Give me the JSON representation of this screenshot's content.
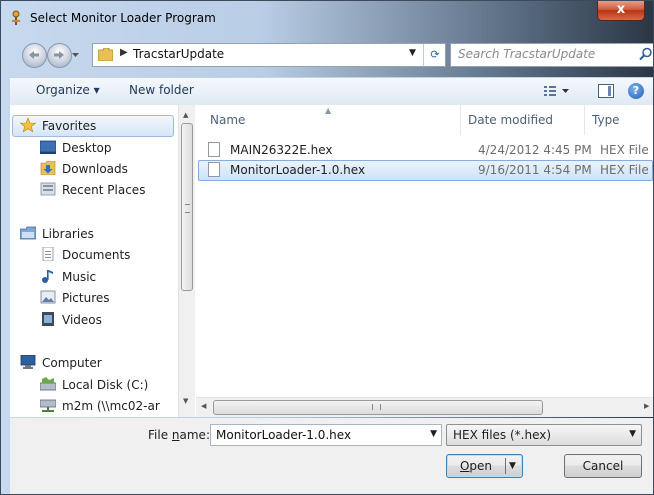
{
  "window": {
    "title": "Select Monitor Loader Program",
    "close_label": "x"
  },
  "navbar": {
    "path_folder": "TracstarUpdate",
    "search_placeholder": "Search TracstarUpdate"
  },
  "toolbar": {
    "organize_label": "Organize ▾",
    "new_folder_label": "New folder",
    "help_label": "?"
  },
  "nav_pane": {
    "favorites": {
      "label": "Favorites",
      "items": [
        "Desktop",
        "Downloads",
        "Recent Places"
      ]
    },
    "libraries": {
      "label": "Libraries",
      "items": [
        "Documents",
        "Music",
        "Pictures",
        "Videos"
      ]
    },
    "computer": {
      "label": "Computer",
      "items": [
        "Local Disk (C:)",
        "m2m (\\\\mc02-ar"
      ]
    }
  },
  "file_list": {
    "columns": [
      "Name",
      "Date modified",
      "Type"
    ],
    "rows": [
      {
        "name": "MAIN26322E.hex",
        "date": "4/24/2012 4:45 PM",
        "type": "HEX File",
        "selected": false
      },
      {
        "name": "MonitorLoader-1.0.hex",
        "date": "9/16/2011 4:54 PM",
        "type": "HEX File",
        "selected": true
      }
    ]
  },
  "bottom": {
    "file_name_label_pre": "File ",
    "file_name_label_u": "n",
    "file_name_label_post": "ame:",
    "file_name_value": "MonitorLoader-1.0.hex",
    "file_type_value": "HEX files (*.hex)",
    "open_label_u": "O",
    "open_label_rest": "pen",
    "cancel_label": "Cancel"
  },
  "colors": {
    "selection": "#cde2f8",
    "link_text": "#1e395b",
    "close_button": "#c84a2a"
  }
}
